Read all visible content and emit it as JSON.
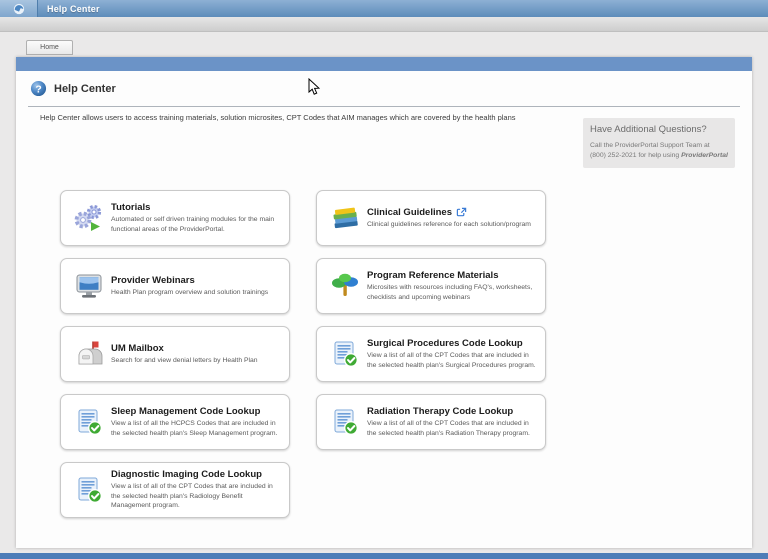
{
  "titlebar": {
    "title": "Help Center",
    "icon": "help-center-app-icon"
  },
  "tabs": {
    "home": "Home"
  },
  "page": {
    "title": "Help Center",
    "help_icon_glyph": "?",
    "description": "Help Center allows users to access training materials, solution microsites, CPT Codes that AIM manages which are covered by the health plans"
  },
  "help_box": {
    "title": "Have Additional Questions?",
    "line1": "Call the ProviderPortal Support Team at",
    "line2_prefix": "(800) 252-2021 for help using ",
    "line2_brand": "ProviderPortal"
  },
  "cards": [
    {
      "icon": "gears-icon",
      "title": "Tutorials",
      "desc": "Automated or self driven training modules for the main functional areas of the ProviderPortal."
    },
    {
      "icon": "books-icon",
      "title": "Clinical Guidelines",
      "external_link": true,
      "desc": "Clinical guidelines reference for each solution/program"
    },
    {
      "icon": "monitor-icon",
      "title": "Provider Webinars",
      "desc": "Health Plan program overview and solution trainings"
    },
    {
      "icon": "tree-icon",
      "title": "Program Reference Materials",
      "desc": "Microsites with resources including FAQ's, worksheets, checklists and upcoming webinars"
    },
    {
      "icon": "mailbox-icon",
      "title": "UM Mailbox",
      "desc": "Search for and view denial letters by Health Plan"
    },
    {
      "icon": "code-list-icon",
      "title": "Surgical Procedures Code Lookup",
      "desc": "View a list of all of the CPT Codes that are included in the selected health plan's Surgical Procedures program."
    },
    {
      "icon": "code-list-icon",
      "title": "Sleep Management Code Lookup",
      "desc": "View a list of all the HCPCS Codes that are included in the selected health plan's Sleep Management program."
    },
    {
      "icon": "code-list-icon",
      "title": "Radiation Therapy Code Lookup",
      "desc": "View a list of all of the CPT Codes that are included in the selected health plan's Radiation Therapy program."
    },
    {
      "icon": "code-list-icon",
      "title": "Diagnostic Imaging Code Lookup",
      "desc": "View a list of all of the CPT Codes that are included in the selected health plan's Radiology Benefit Management program."
    }
  ],
  "colors": {
    "titlebar_top": "#8db0d4",
    "titlebar_bottom": "#5d8cba",
    "content_bluebar": "#6b93c7",
    "footer": "#4d7db8",
    "success_green": "#3faa34",
    "link_blue": "#3a7bd5"
  }
}
